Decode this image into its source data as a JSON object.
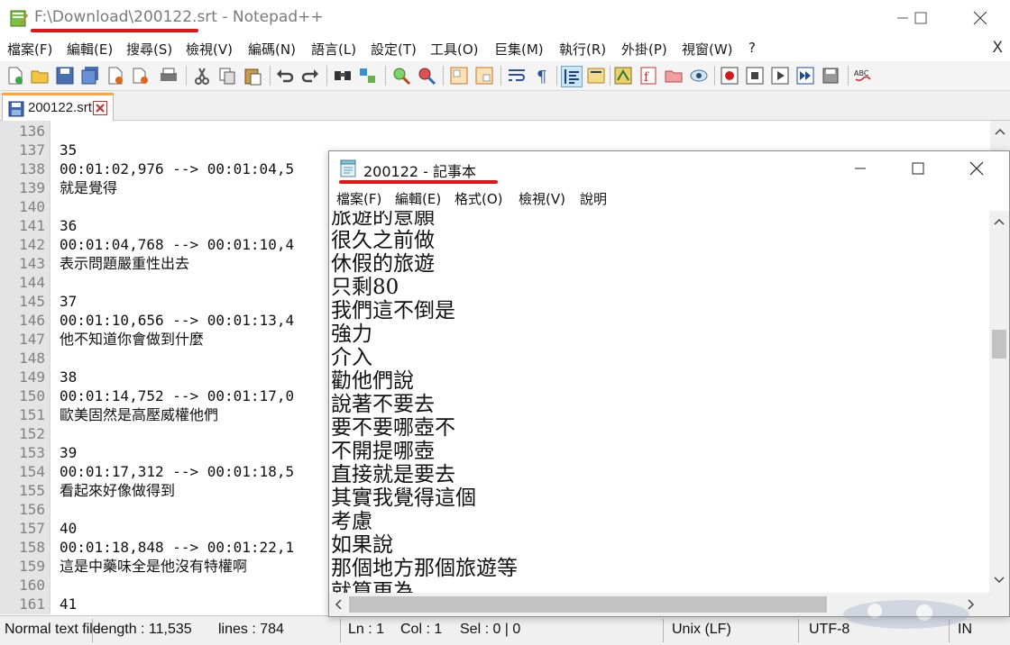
{
  "npp": {
    "title": "F:\\Download\\200122.srt - Notepad++",
    "menu": [
      "檔案(F)",
      "編輯(E)",
      "搜尋(S)",
      "檢視(V)",
      "編碼(N)",
      "語言(L)",
      "設定(T)",
      "工具(O)",
      "巨集(M)",
      "執行(R)",
      "外掛(P)",
      "視窗(W)",
      "?"
    ],
    "menu_close": "X",
    "tab_label": "200122.srt",
    "lines": [
      {
        "n": "136",
        "t": ""
      },
      {
        "n": "137",
        "t": "35"
      },
      {
        "n": "138",
        "t": "00:01:02,976 --> 00:01:04,5"
      },
      {
        "n": "139",
        "t": "就是覺得"
      },
      {
        "n": "140",
        "t": ""
      },
      {
        "n": "141",
        "t": "36"
      },
      {
        "n": "142",
        "t": "00:01:04,768 --> 00:01:10,4"
      },
      {
        "n": "143",
        "t": "表示問題嚴重性出去"
      },
      {
        "n": "144",
        "t": ""
      },
      {
        "n": "145",
        "t": "37"
      },
      {
        "n": "146",
        "t": "00:01:10,656 --> 00:01:13,4"
      },
      {
        "n": "147",
        "t": "他不知道你會做到什麼"
      },
      {
        "n": "148",
        "t": ""
      },
      {
        "n": "149",
        "t": "38"
      },
      {
        "n": "150",
        "t": "00:01:14,752 --> 00:01:17,0"
      },
      {
        "n": "151",
        "t": "歐美固然是高壓威權他們"
      },
      {
        "n": "152",
        "t": ""
      },
      {
        "n": "153",
        "t": "39"
      },
      {
        "n": "154",
        "t": "00:01:17,312 --> 00:01:18,5"
      },
      {
        "n": "155",
        "t": "看起來好像做得到"
      },
      {
        "n": "156",
        "t": ""
      },
      {
        "n": "157",
        "t": "40"
      },
      {
        "n": "158",
        "t": "00:01:18,848 --> 00:01:22,1"
      },
      {
        "n": "159",
        "t": "這是中藥味全是他沒有特權啊"
      },
      {
        "n": "160",
        "t": ""
      },
      {
        "n": "161",
        "t": "41"
      }
    ],
    "status": {
      "lang": "Normal text file",
      "length": "length : 11,535",
      "lines": "lines : 784",
      "ln": "Ln : 1",
      "col": "Col : 1",
      "sel": "Sel : 0 | 0",
      "eol": "Unix (LF)",
      "enc": "UTF-8",
      "ins": "IN"
    }
  },
  "notepad": {
    "title": "200122 - 記事本",
    "menu": [
      "檔案(F)",
      "編輯(E)",
      "格式(O)",
      "檢視(V)",
      "說明"
    ],
    "lines": [
      "旅遊的意願",
      "很久之前做",
      "休假的旅遊",
      "只剩80",
      "我們這不倒是",
      "強力",
      "介入",
      "勸他們說",
      "說著不要去",
      "要不要哪壺不",
      "不開提哪壺",
      "直接就是要去",
      "其實我覺得這個",
      "考慮",
      "如果說",
      "那個地方那個旅遊等",
      "就算更為"
    ]
  },
  "colors": {
    "underline": "#e01616",
    "tab_accent": "#f8a53c",
    "gutter": "#e4e4e4"
  },
  "icons": [
    "notepadpp-app-icon",
    "minimize-icon",
    "maximize-icon",
    "close-icon",
    "save-icon",
    "notepad-app-icon",
    "scroll-up-icon",
    "scroll-down-icon",
    "scroll-left-icon",
    "scroll-right-icon"
  ]
}
